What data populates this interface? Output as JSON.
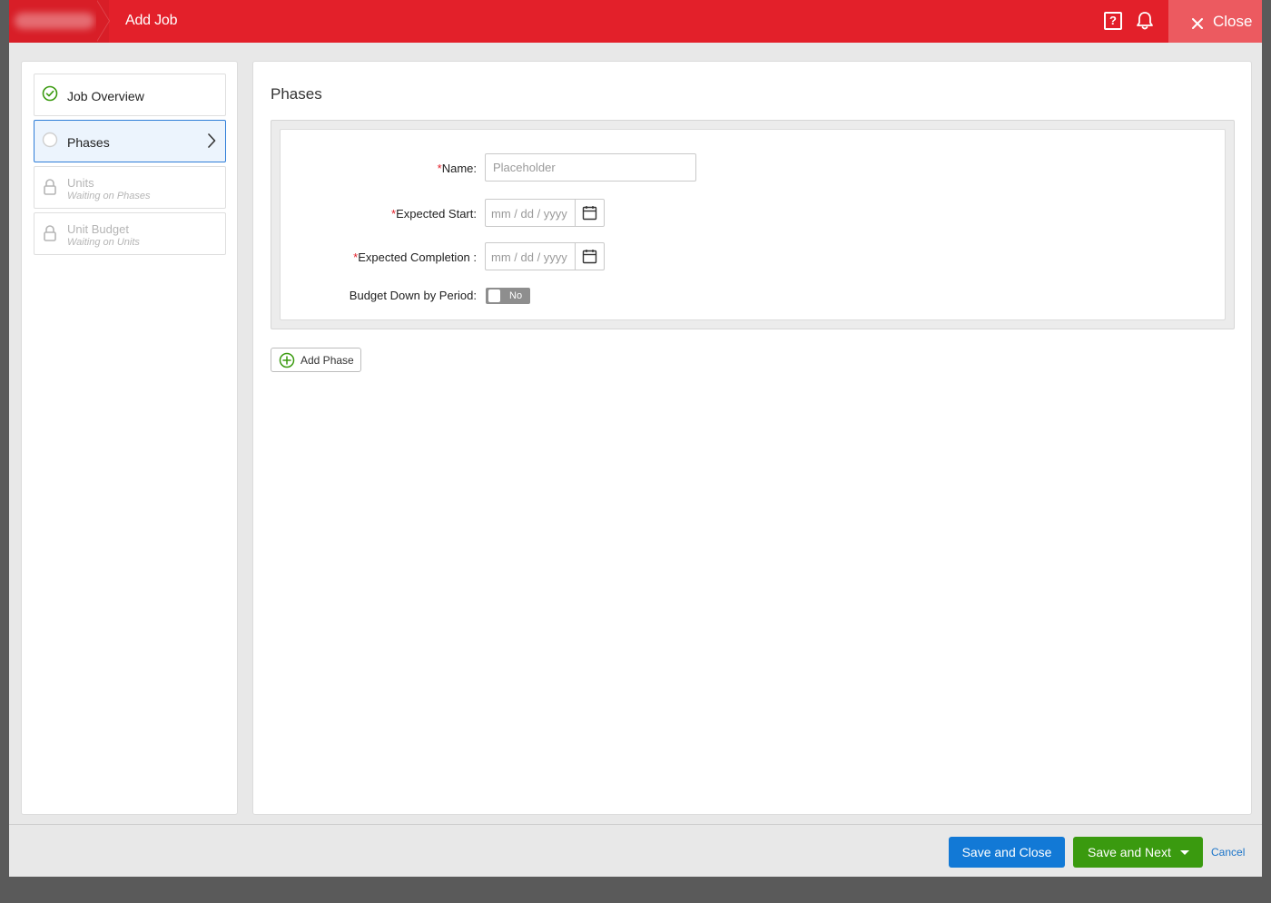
{
  "header": {
    "title": "Add Job",
    "close_label": "Close",
    "help_icon": "help-icon",
    "bell_icon": "bell-icon",
    "brand_color": "#e3202a"
  },
  "steps": [
    {
      "label": "Job Overview",
      "sub": "",
      "state": "complete",
      "icon": "check-circle-icon"
    },
    {
      "label": "Phases",
      "sub": "",
      "state": "active",
      "icon": "empty-circle-icon"
    },
    {
      "label": "Units",
      "sub": "Waiting on Phases",
      "state": "locked",
      "icon": "lock-icon"
    },
    {
      "label": "Unit Budget",
      "sub": "Waiting on Units",
      "state": "locked",
      "icon": "lock-icon"
    }
  ],
  "main": {
    "section_title": "Phases",
    "form": {
      "name_label": "Name:",
      "name_placeholder": "Placeholder",
      "start_label": "Expected Start:",
      "start_placeholder": "mm / dd / yyyy",
      "completion_label": "Expected Completion :",
      "completion_placeholder": "mm / dd / yyyy",
      "required_mark": "*",
      "budget_label": "Budget Down by Period:",
      "budget_toggle": "No"
    },
    "add_phase_label": "Add Phase"
  },
  "footer": {
    "save_close_label": "Save and Close",
    "save_next_label": "Save and Next",
    "cancel_label": "Cancel",
    "save_close_color": "#1279d6",
    "save_next_color": "#3a9a0f"
  }
}
